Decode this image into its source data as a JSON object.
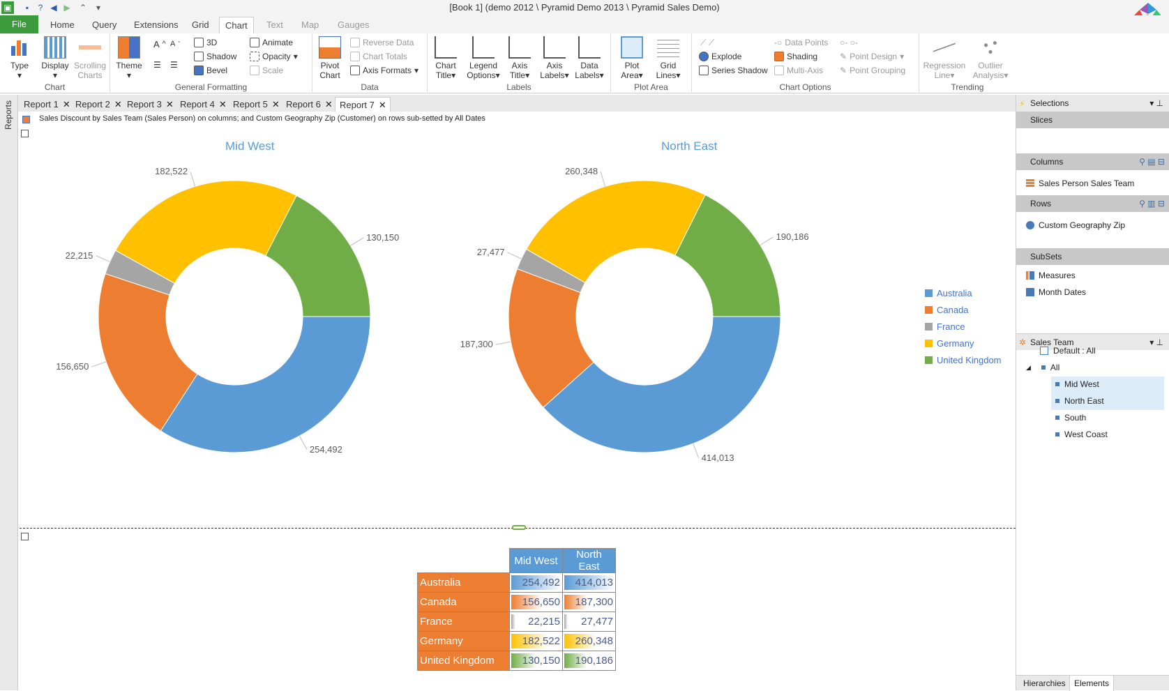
{
  "window": {
    "title": "[Book 1]   (demo 2012 \\  Pyramid Demo 2013 \\  Pyramid Sales Demo)"
  },
  "ribbon_tabs": [
    "File",
    "Home",
    "Query",
    "Extensions",
    "Grid",
    "Chart",
    "Text",
    "Map",
    "Gauges"
  ],
  "ribbon": {
    "chart_group": {
      "label": "Chart",
      "type": "Type",
      "display": "Display",
      "scrolling": "Scrolling Charts"
    },
    "general": {
      "label": "General Formatting",
      "theme": "Theme",
      "three_d": "3D",
      "shadow": "Shadow",
      "bevel": "Bevel",
      "animate": "Animate",
      "opacity": "Opacity",
      "scale": "Scale",
      "font_up": "A",
      "font_down": "A"
    },
    "data": {
      "label": "Data",
      "pivot": "Pivot Chart",
      "reverse": "Reverse Data",
      "totals": "Chart Totals",
      "axis_formats": "Axis Formats"
    },
    "labels": {
      "label": "Labels",
      "chart_title": "Chart Title",
      "legend": "Legend Options",
      "axis_title": "Axis Title",
      "axis_labels": "Axis Labels",
      "data_labels": "Data Labels"
    },
    "plot": {
      "label": "Plot Area",
      "plot_area": "Plot Area",
      "grid_lines": "Grid Lines"
    },
    "options": {
      "label": "Chart Options",
      "explode": "Explode",
      "series_shadow": "Series Shadow",
      "data_points": "Data Points",
      "shading": "Shading",
      "multi_axis": "Multi-Axis",
      "point_design": "Point Design",
      "point_grouping": "Point Grouping"
    },
    "trending": {
      "label": "Trending",
      "regression": "Regression Line",
      "outlier": "Outlier Analysis"
    }
  },
  "sidebar_label": "Reports",
  "doc_tabs": [
    "Report 1",
    "Report 2",
    "Report 3",
    "Report 4",
    "Report 5",
    "Report 6",
    "Report 7"
  ],
  "description": "Sales Discount by Sales Team (Sales Person) on columns; and Custom Geography Zip (Customer) on rows sub-setted by All Dates",
  "chart_data": {
    "type": "pie",
    "categories": [
      "Australia",
      "Canada",
      "France",
      "Germany",
      "United Kingdom"
    ],
    "series": [
      {
        "name": "Mid West",
        "values": [
          254492,
          156650,
          22215,
          182522,
          130150
        ]
      },
      {
        "name": "North East",
        "values": [
          414013,
          187300,
          27477,
          260348,
          190186
        ]
      }
    ],
    "colors": [
      "#5b9bd5",
      "#ed7d31",
      "#a5a5a5",
      "#ffc000",
      "#70ad47"
    ],
    "legend": "right"
  },
  "value_labels": {
    "Mid West": [
      "254,492",
      "156,650",
      "22,215",
      "182,522",
      "130,150"
    ],
    "North East": [
      "414,013",
      "187,300",
      "27,477",
      "260,348",
      "190,186"
    ]
  },
  "right_panel": {
    "selections": "Selections",
    "slices": "Slices",
    "columns": "Columns",
    "columns_item": "Sales Person Sales Team",
    "rows": "Rows",
    "rows_item": "Custom Geography Zip",
    "subsets": "SubSets",
    "measures": "Measures",
    "month_dates": "Month Dates",
    "sales_team": "Sales Team",
    "default_all": "Default : All",
    "all": "All",
    "members": [
      "Mid West",
      "North East",
      "South",
      "West Coast"
    ],
    "tab_hierarchies": "Hierarchies",
    "tab_elements": "Elements"
  }
}
